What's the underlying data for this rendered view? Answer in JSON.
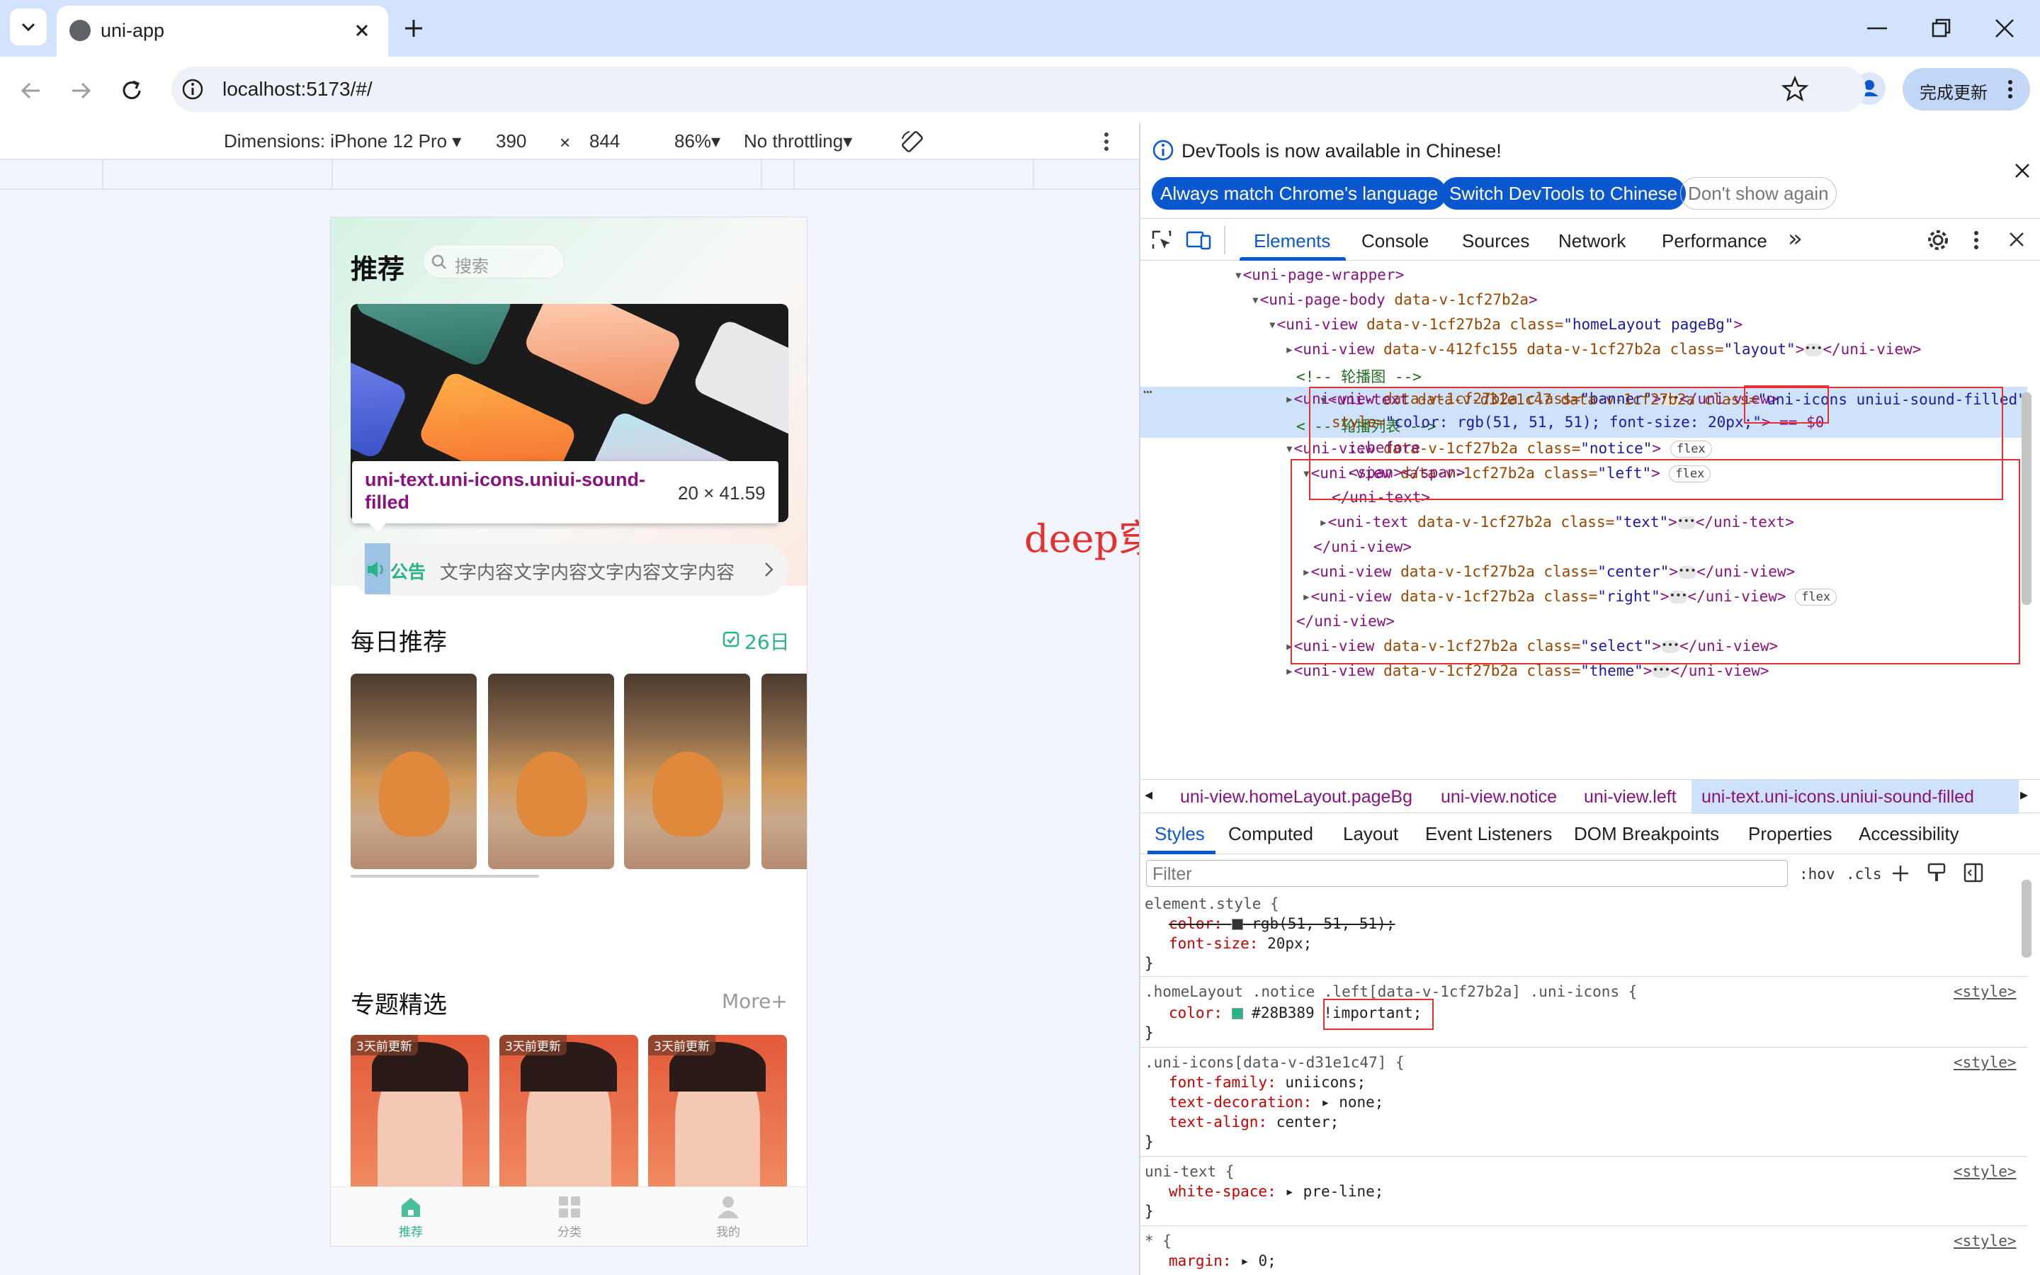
{
  "browser": {
    "tab_title": "uni-app",
    "url": "localhost:5173/#/",
    "update_label": "完成更新"
  },
  "device_toolbar": {
    "dimensions": "Dimensions: iPhone 12 Pro",
    "width": "390",
    "times": "×",
    "height": "844",
    "zoom": "86%",
    "throttle": "No throttling"
  },
  "app": {
    "title": "推荐",
    "search_placeholder": "搜索",
    "tooltip_selector": "uni-text.uni-icons.uniui-sound-filled",
    "tooltip_size": "20 × 41.59",
    "notice_label": "公告",
    "notice_text": "文字内容文字内容文字内容文字内容",
    "daily_title": "每日推荐",
    "daily_date": "26日",
    "topic_title": "专题精选",
    "topic_more": "More+",
    "topic_badge": "3天前更新",
    "tabs": [
      "推荐",
      "分类",
      "我的"
    ],
    "accent": "#28B389"
  },
  "annotation": "deep穿透",
  "devtools": {
    "banner": "DevTools is now available in Chinese!",
    "btn_match": "Always match Chrome's language",
    "btn_switch": "Switch DevTools to Chinese",
    "btn_dont": "Don't show again",
    "tabs": [
      "Elements",
      "Console",
      "Sources",
      "Network",
      "Performance"
    ],
    "more_tabs": "»",
    "dom": {
      "l1": "<uni-page-wrapper>",
      "l2a": "<uni-page-body ",
      "l2b": "data-v-1cf27b2a",
      "l2c": ">",
      "l3a": "<uni-view ",
      "l3b": "data-v-1cf27b2a class=",
      "l3c": "\"homeLayout pageBg\"",
      "l3d": ">",
      "l4a": "<uni-view ",
      "l4b": "data-v-412fc155 data-v-1cf27b2a class=",
      "l4c": "\"layout\"",
      "l4d": ">",
      "l4e": "</uni-view>",
      "l5": "<!-- 轮播图 -->",
      "l6a": "<uni-view ",
      "l6b": "data-v-1cf27b2a class=",
      "l6c": "\"banner\"",
      "l6d": ">",
      "l6e": "</uni-view>",
      "l7": "<!-- 轮播列表 -->",
      "l8a": "<uni-view ",
      "l8b": "data-v-1cf27b2a class=",
      "l8c": "\"notice\"",
      "l8d": ">",
      "l9a": "<uni-view ",
      "l9b": "data-v-1cf27b2a class=",
      "l9c": "\"left\"",
      "l9d": ">",
      "l10a": "<uni-text ",
      "l10b": "data-v-d31e1c47 data-v-1cf27b2a class=",
      "l10c": "\"uni-icons",
      "l10d": " uniui-sound-filled\"",
      "l11a": "style=",
      "l11b": "\"color: rgb(51, 51, 51); font-size: 20px;\"",
      "l11c": "> == $0",
      "l12": "::before",
      "l13": "<span></span>",
      "l14": "</uni-text>",
      "l15a": "<uni-text ",
      "l15b": "data-v-1cf27b2a class=",
      "l15c": "\"text\"",
      "l15d": ">",
      "l15e": "</uni-text>",
      "l16": "</uni-view>",
      "l17a": "<uni-view ",
      "l17b": "data-v-1cf27b2a class=",
      "l17c": "\"center\"",
      "l17d": ">",
      "l17e": "</uni-view>",
      "l18a": "<uni-view ",
      "l18b": "data-v-1cf27b2a class=",
      "l18c": "\"right\"",
      "l18d": ">",
      "l18e": "</uni-view>",
      "l19": "</uni-view>",
      "l20a": "<uni-view ",
      "l20b": "data-v-1cf27b2a class=",
      "l20c": "\"select\"",
      "l20d": ">",
      "l20e": "</uni-view>",
      "l21a": "<uni-view ",
      "l21b": "data-v-1cf27b2a class=",
      "l21c": "\"theme\"",
      "l21d": ">",
      "l21e": "</uni-view>",
      "flex": "flex"
    },
    "breadcrumbs": [
      "uni-view.homeLayout.pageBg",
      "uni-view.notice",
      "uni-view.left",
      "uni-text.uni-icons.uniui-sound-filled"
    ],
    "subtabs": [
      "Styles",
      "Computed",
      "Layout",
      "Event Listeners",
      "DOM Breakpoints",
      "Properties",
      "Accessibility"
    ],
    "filter_placeholder": "Filter",
    "hov": ":hov",
    "cls": ".cls",
    "styles": {
      "r1_sel": "element.style {",
      "r1_p1": "color:",
      "r1_v1": "rgb(51, 51, 51);",
      "r1_p2": "font-size:",
      "r1_v2": "20px;",
      "close": "}",
      "r2_sel": ".homeLayout .notice .left[data-v-1cf27b2a] .uni-icons {",
      "r2_p1": "color:",
      "r2_v1": "#28B389",
      "r2_imp": "!important;",
      "r3_sel": ".uni-icons[data-v-d31e1c47] {",
      "r3_p1": "font-family:",
      "r3_v1": "uniicons;",
      "r3_p2": "text-decoration:",
      "r3_v2": "none;",
      "r3_p3": "text-align:",
      "r3_v3": "center;",
      "r4_sel": "uni-text {",
      "r4_p1": "white-space:",
      "r4_v1": "pre-line;",
      "r5_sel": "* {",
      "r5_p1": "margin:",
      "r5_v1": "0;",
      "src": "<style>"
    }
  }
}
